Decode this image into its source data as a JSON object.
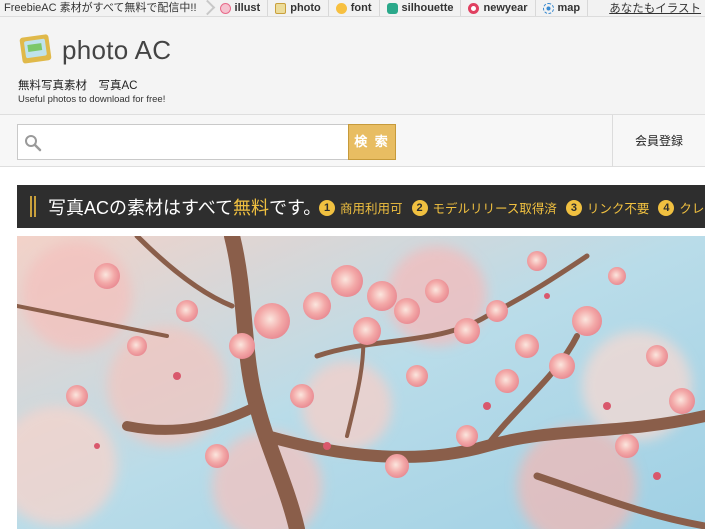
{
  "topnav": {
    "brand": "FreebieAC 素材がすべて無料で配信中!!",
    "items": [
      {
        "label": "illust",
        "icon": "illust-icon",
        "color": "#e86a8a"
      },
      {
        "label": "photo",
        "icon": "photo-icon",
        "color": "#d9b84a"
      },
      {
        "label": "font",
        "icon": "font-icon",
        "color": "#f0a020"
      },
      {
        "label": "silhouette",
        "icon": "silhouette-icon",
        "color": "#2aa88a"
      },
      {
        "label": "newyear",
        "icon": "newyear-icon",
        "color": "#e04060"
      },
      {
        "label": "map",
        "icon": "map-icon",
        "color": "#3a8ad0"
      }
    ],
    "right_link": "あなたもイラスト"
  },
  "header": {
    "logo_text": "photo AC",
    "tagline_jp": "無料写真素材　写真AC",
    "tagline_en": "Useful photos to download for free!"
  },
  "search": {
    "placeholder": "",
    "button_label": "検 索",
    "member_label": "会員登録"
  },
  "banner": {
    "headline_prefix": "写真ACの素材はすべて",
    "headline_highlight": "無料",
    "headline_suffix": "です。",
    "features": [
      {
        "num": "1",
        "label": "商用利用可"
      },
      {
        "num": "2",
        "label": "モデルリリース取得済"
      },
      {
        "num": "3",
        "label": "リンク不要"
      },
      {
        "num": "4",
        "label": "クレジット"
      }
    ]
  },
  "colors": {
    "accent": "#e8bd62",
    "banner_bg": "#2e2e2e",
    "banner_highlight": "#f0c040"
  }
}
